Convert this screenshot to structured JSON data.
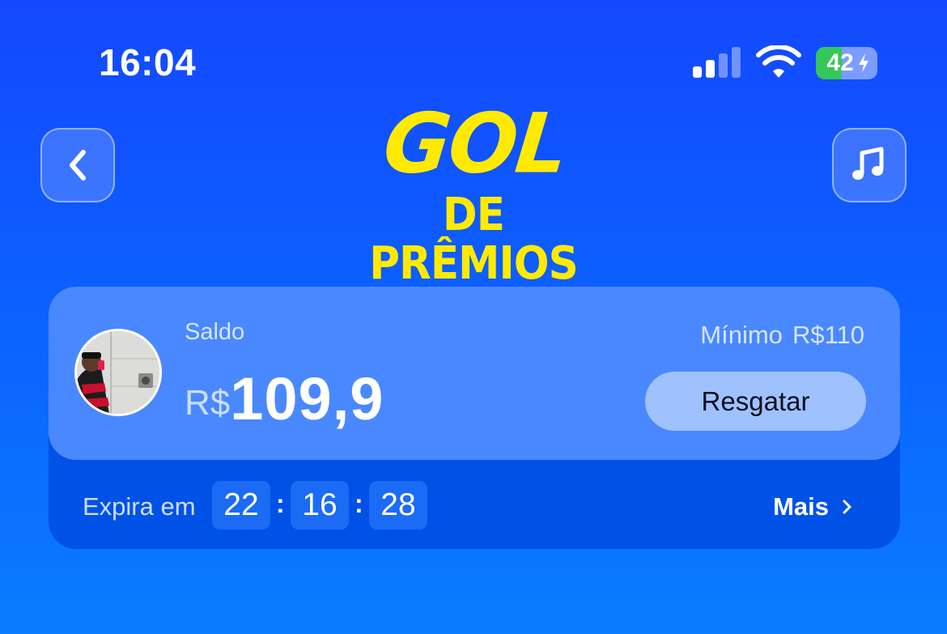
{
  "status_bar": {
    "time": "16:04",
    "battery_level": "42"
  },
  "header": {
    "logo_line1": "GOL",
    "logo_line2": "DE PRÊMIOS",
    "back_icon": "chevron-left-icon",
    "music_icon": "music-note-icon"
  },
  "balance_card": {
    "saldo_label": "Saldo",
    "currency": "R$",
    "amount": "109,9",
    "minimum_label": "Mínimo",
    "minimum_value": "R$110",
    "redeem_label": "Resgatar",
    "expires_label": "Expira em",
    "timer": {
      "hours": "22",
      "minutes": "16",
      "seconds": "28",
      "separator": ":"
    },
    "more_label": "Mais"
  },
  "colors": {
    "background": "#1448ff",
    "card_top": "#4a88ff",
    "card_bottom": "#0052e6",
    "logo_yellow": "#ffea00",
    "battery_green": "#34c759",
    "redeem_button": "#9fc2ff"
  }
}
